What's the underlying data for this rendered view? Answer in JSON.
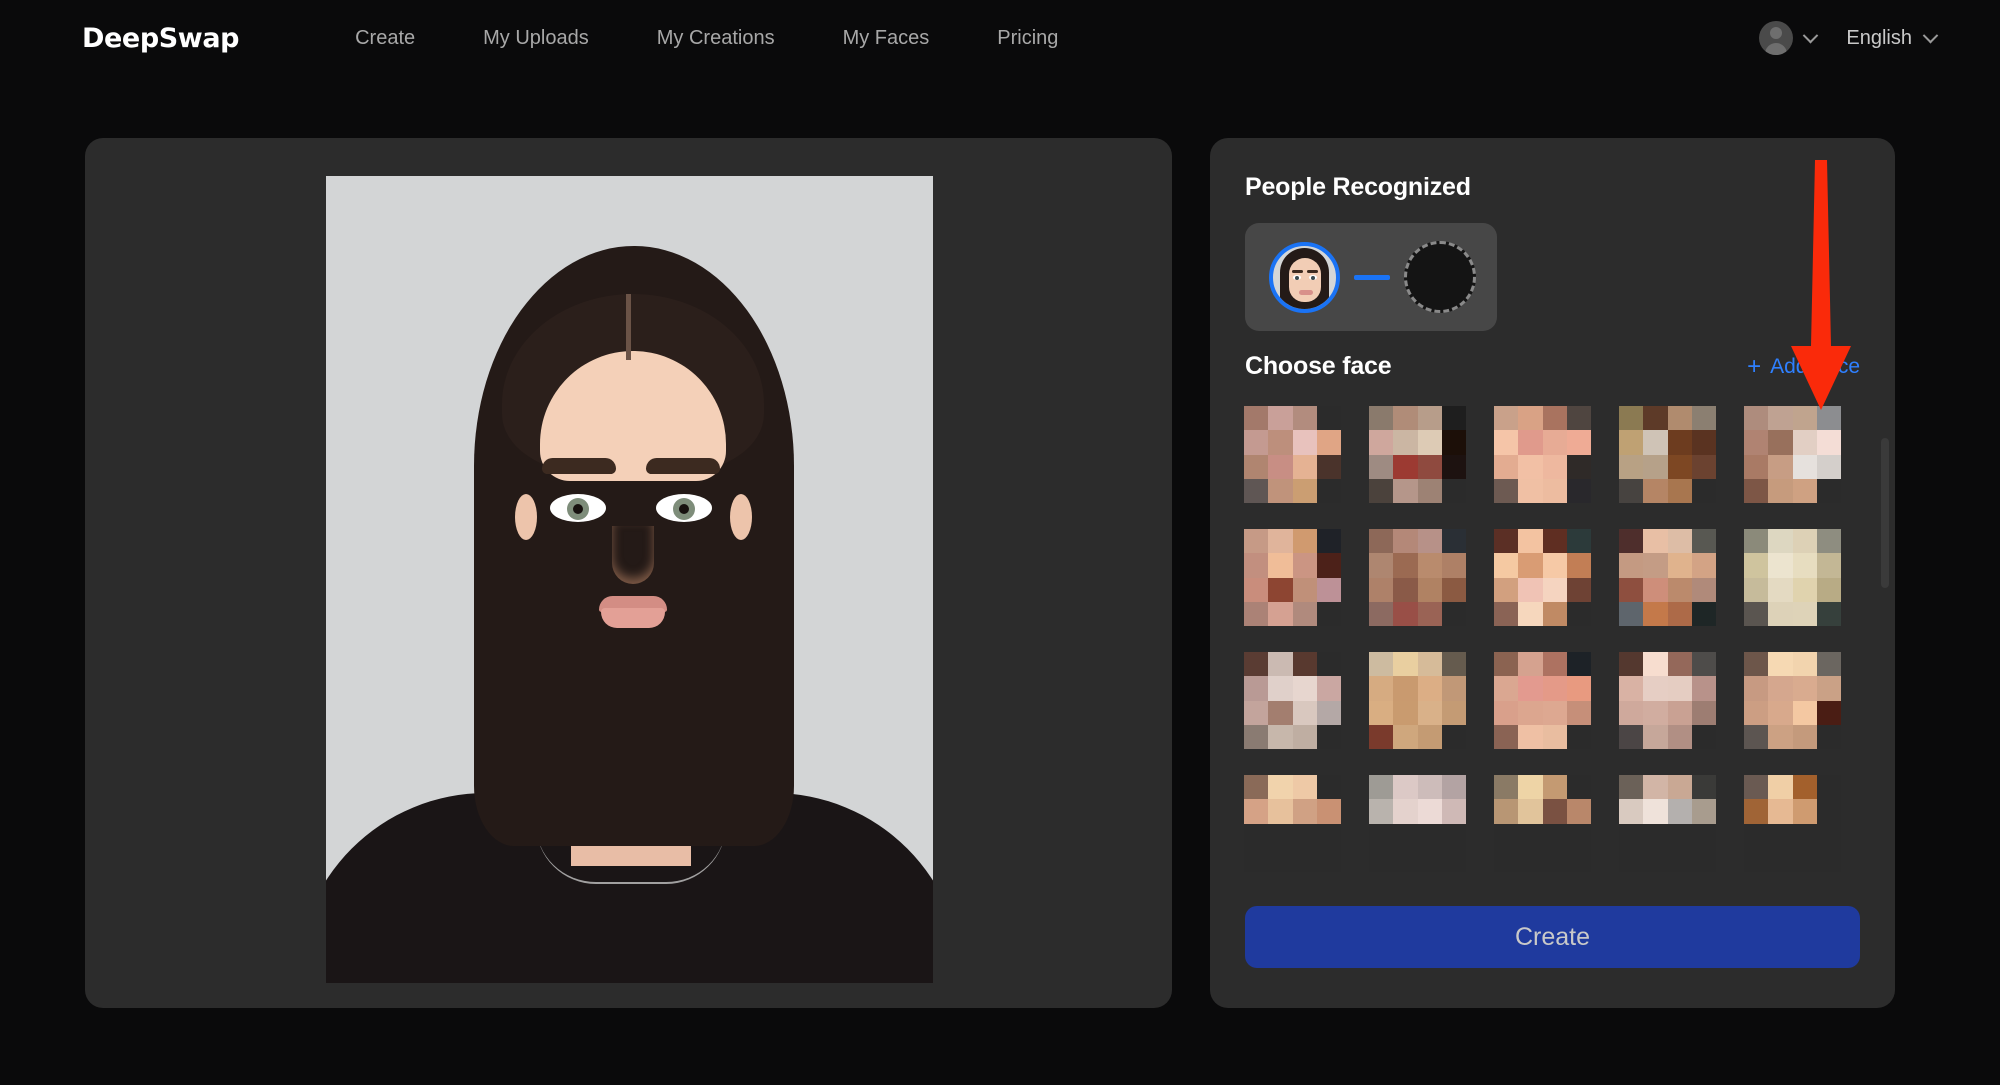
{
  "header": {
    "brand_deep": "Deep",
    "brand_swap": "Swap",
    "nav": [
      {
        "label": "Create"
      },
      {
        "label": "My Uploads"
      },
      {
        "label": "My Creations"
      },
      {
        "label": "My Faces"
      },
      {
        "label": "Pricing"
      }
    ],
    "account_icon": "user-avatar-icon",
    "account_chevron": "chevron-down-icon",
    "language": "English",
    "language_chevron": "chevron-down-icon"
  },
  "left_panel": {
    "preview_alt": "uploaded-portrait-photo"
  },
  "right_panel": {
    "people_recognized_title": "People Recognized",
    "source_face_alt": "detected-face-thumbnail",
    "swap_arrow_icon": "arrow-right-icon",
    "target_placeholder_alt": "empty-target-face-slot",
    "choose_face_label": "Choose face",
    "add_face_label": "Add Face",
    "add_face_plus": "+",
    "create_button_label": "Create",
    "faces_grid": {
      "columns": 5,
      "rows": 4,
      "tiles": [
        {
          "id": "face-1",
          "palette": [
            "#a3796a",
            "#c9a099",
            "#b28c7e",
            "#2b2b2b",
            "#c49a91",
            "#bd8f7c",
            "#e8c2bd",
            "#e0a585",
            "#b08570",
            "#c88e84",
            "#e5b293",
            "#4a332b",
            "#5f5654",
            "#c0937b",
            "#cb9e72",
            "#2b2b2b"
          ]
        },
        {
          "id": "face-2",
          "palette": [
            "#8a7a6c",
            "#b08c78",
            "#b79d8a",
            "#1e1e1e",
            "#cfa79d",
            "#cbb6a3",
            "#ddcbb5",
            "#1c0f08",
            "#9e8b82",
            "#9c3a32",
            "#8f4a3f",
            "#1d1210",
            "#4b423c",
            "#b5968a",
            "#9d8274",
            "#2b2b2b"
          ]
        },
        {
          "id": "face-3",
          "palette": [
            "#c9a18a",
            "#d9a285",
            "#a9735f",
            "#4f4540",
            "#f5c5a8",
            "#e09a8c",
            "#e7ab95",
            "#efab95",
            "#e3ac91",
            "#f2c0a5",
            "#eeb89f",
            "#2f2a28",
            "#6d5a52",
            "#f0c0a4",
            "#edbca0",
            "#29282c"
          ]
        },
        {
          "id": "face-4",
          "palette": [
            "#8b7a52",
            "#5d3a28",
            "#b08b6e",
            "#8b7f71",
            "#bfa173",
            "#cfc3b6",
            "#6d3c1f",
            "#5a3321",
            "#b8a184",
            "#b6a189",
            "#7d4723",
            "#6b4230",
            "#474340",
            "#b58565",
            "#a8764f",
            "#2b2b2b"
          ]
        },
        {
          "id": "face-5",
          "palette": [
            "#ae8c7d",
            "#bfa292",
            "#c0a48e",
            "#8c8d90",
            "#b08372",
            "#98705c",
            "#e2cfc4",
            "#f4ddd6",
            "#a97a65",
            "#c79d84",
            "#e6e1dd",
            "#d4cfcb",
            "#7d5646",
            "#c69b7d",
            "#cfa182",
            "#2b2b2b"
          ]
        },
        {
          "id": "face-6",
          "palette": [
            "#c69a86",
            "#e0b49b",
            "#d09a6f",
            "#1f2228",
            "#c28f7f",
            "#f0bd98",
            "#cb9583",
            "#4c2119",
            "#c98d7c",
            "#8d4532",
            "#c09079",
            "#bd9197",
            "#ab8276",
            "#d5a192",
            "#b08a7d",
            "#2b2b2b"
          ]
        },
        {
          "id": "face-7",
          "palette": [
            "#8d6858",
            "#b48878",
            "#b79188",
            "#2a2f35",
            "#ae8670",
            "#9b6a52",
            "#b98b6d",
            "#ae8066",
            "#ae8169",
            "#8a5a48",
            "#b08263",
            "#8b5a42",
            "#8c6a61",
            "#994f47",
            "#9a6355",
            "#2b2b2b"
          ]
        },
        {
          "id": "face-8",
          "palette": [
            "#5b2f25",
            "#f3c3a1",
            "#5f2e22",
            "#2c3a3a",
            "#f5c9a2",
            "#d99c74",
            "#f6c9a6",
            "#c27e55",
            "#d2a07f",
            "#f0c3b5",
            "#f5d4c0",
            "#6e4234",
            "#8a6355",
            "#f6d7bd",
            "#c08a64",
            "#2b2b2b"
          ]
        },
        {
          "id": "face-9",
          "palette": [
            "#4e2e2c",
            "#e8bfa5",
            "#ddbda6",
            "#585852",
            "#c49a82",
            "#c49c85",
            "#e0b38d",
            "#d3a385",
            "#8e4f3f",
            "#ce8e7a",
            "#bb8a6c",
            "#b08a7a",
            "#5e656c",
            "#c4794a",
            "#ad6a48",
            "#1e2626"
          ]
        },
        {
          "id": "face-10",
          "palette": [
            "#8b8a7a",
            "#ddd7c1",
            "#ddd1b6",
            "#8e8d80",
            "#cfc49e",
            "#ece4cf",
            "#e7ddc0",
            "#c3b795",
            "#c6bb9b",
            "#e4dac2",
            "#e0d3ae",
            "#b8ab85",
            "#5a5550",
            "#ddd2b8",
            "#ded3b8",
            "#36403c"
          ]
        },
        {
          "id": "face-11",
          "palette": [
            "#5a3c33",
            "#cbbab2",
            "#58392f",
            "#2b2b2b",
            "#b99a95",
            "#e0d0ca",
            "#e7d6cf",
            "#caa7a2",
            "#c3a49c",
            "#a37e6f",
            "#d9c8bf",
            "#b4a8a6",
            "#8a7b72",
            "#c7b7ab",
            "#bfaea2",
            "#2b2b2b"
          ]
        },
        {
          "id": "face-12",
          "palette": [
            "#cdbba0",
            "#e9cfa0",
            "#d6bb99",
            "#655b4e",
            "#d6ab81",
            "#c99a6f",
            "#dcae85",
            "#c19877",
            "#d9ae82",
            "#c99b6f",
            "#d9b189",
            "#c49b74",
            "#7a3a2c",
            "#cfa77d",
            "#c49b73",
            "#2b2b2b"
          ]
        },
        {
          "id": "face-13",
          "palette": [
            "#8b6351",
            "#d5a28f",
            "#ad7261",
            "#1d2227",
            "#daa791",
            "#e39a8f",
            "#e49a88",
            "#e89a80",
            "#d9a08b",
            "#dca68f",
            "#dda891",
            "#c68f79",
            "#8a6354",
            "#efc0a4",
            "#e9bda0",
            "#2b2b2b"
          ]
        },
        {
          "id": "face-14",
          "palette": [
            "#54382f",
            "#f7ddcf",
            "#94685a",
            "#4e4c4a",
            "#d9b2a4",
            "#e6cec4",
            "#e5cdc2",
            "#b8928a",
            "#cfa99c",
            "#d1ada0",
            "#c9a193",
            "#9d7d72",
            "#4b4545",
            "#c6a79a",
            "#b18f84",
            "#2b2b2b"
          ]
        },
        {
          "id": "face-15",
          "palette": [
            "#6d564a",
            "#f6d9b3",
            "#f2d4ae",
            "#6b6660",
            "#c79a82",
            "#d5a78e",
            "#d9ab8f",
            "#caa186",
            "#cc9e83",
            "#d8a98c",
            "#f4c8a2",
            "#4a1d14",
            "#5c5551",
            "#cca183",
            "#c49a7c",
            "#2b2b2b"
          ]
        },
        {
          "id": "face-16",
          "palette": [
            "#8a6a58",
            "#f1d3ac",
            "#eec9a6",
            "#2b2b2b",
            "#d5a286",
            "#e7c19c",
            "#d0a184",
            "#c99173",
            "#2b2b2b",
            "#2b2b2b",
            "#2b2b2b",
            "#2b2b2b",
            "#2b2b2b",
            "#2b2b2b",
            "#2b2b2b",
            "#2b2b2b"
          ]
        },
        {
          "id": "face-17",
          "palette": [
            "#9e9b95",
            "#dcc9c6",
            "#cdbcba",
            "#b3a3a3",
            "#b9b3ad",
            "#e4d2cd",
            "#ecdad6",
            "#cfb9b6",
            "#2b2b2b",
            "#2b2b2b",
            "#2b2b2b",
            "#2b2b2b",
            "#2b2b2b",
            "#2b2b2b",
            "#2b2b2b",
            "#2b2b2b"
          ]
        },
        {
          "id": "face-18",
          "palette": [
            "#8a7a65",
            "#eed4a6",
            "#c49a72",
            "#2b2b2b",
            "#b89674",
            "#e1c49b",
            "#7a5142",
            "#b9876a",
            "#2b2b2b",
            "#2b2b2b",
            "#2b2b2b",
            "#2b2b2b",
            "#2b2b2b",
            "#2b2b2b",
            "#2b2b2b",
            "#2b2b2b"
          ]
        },
        {
          "id": "face-19",
          "palette": [
            "#6b6158",
            "#d2b5a6",
            "#c9a894",
            "#3a3a38",
            "#d9cac0",
            "#efe2da",
            "#b4b0ae",
            "#a89c8e",
            "#2b2b2b",
            "#2b2b2b",
            "#2b2b2b",
            "#2b2b2b",
            "#2b2b2b",
            "#2b2b2b",
            "#2b2b2b",
            "#2b2b2b"
          ]
        },
        {
          "id": "face-20",
          "palette": [
            "#6a5a52",
            "#f0cfa6",
            "#a3602c",
            "#2b2b2b",
            "#a06436",
            "#e6b993",
            "#cf9b70",
            "#b5secret",
            "#2b2b2b",
            "#2b2b2b",
            "#2b2b2b",
            "#2b2b2b",
            "#2b2b2b",
            "#2b2b2b",
            "#2b2b2b",
            "#2b2b2b"
          ]
        }
      ]
    }
  },
  "annotation": {
    "arrow_icon": "red-down-arrow-annotation",
    "arrow_color": "#fa2a0a"
  },
  "colors": {
    "page_background": "#0a0a0b",
    "panel_background": "#2c2c2c",
    "card_background": "#474747",
    "accent_blue": "#1a73f5",
    "link_blue": "#2f80ff",
    "create_button": "#1f3a9e",
    "annotation_red": "#fa2a0a"
  }
}
